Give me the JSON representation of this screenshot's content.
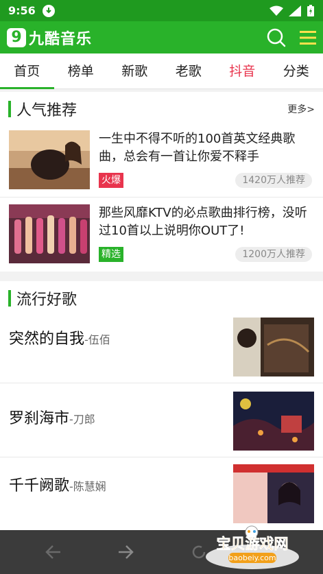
{
  "status": {
    "time": "9:56"
  },
  "app": {
    "logo_digit": "9",
    "logo_text": "九酷音乐"
  },
  "nav_tabs": [
    "首页",
    "榜单",
    "新歌",
    "老歌",
    "抖音",
    "分类"
  ],
  "recommend": {
    "title": "人气推荐",
    "more": "更多>",
    "items": [
      {
        "title": "一生中不得不听的100首英文经典歌曲，总会有一首让你爱不释手",
        "tag": "火爆",
        "count": "1420万人推荐"
      },
      {
        "title": "那些风靡KTV的必点歌曲排行榜，没听过10首以上说明你OUT了!",
        "tag": "精选",
        "count": "1200万人推荐"
      }
    ]
  },
  "popular": {
    "title": "流行好歌",
    "songs": [
      {
        "name": "突然的自我",
        "artist": "-伍佰"
      },
      {
        "name": "罗刹海市",
        "artist": "-刀郎"
      },
      {
        "name": "千千阙歌",
        "artist": "-陈慧娴"
      }
    ]
  },
  "watermark": {
    "text": "宝贝游戏网",
    "url": "baobeiy.com"
  },
  "colors": {
    "primary": "#29b22a",
    "hot": "#e8344d"
  }
}
